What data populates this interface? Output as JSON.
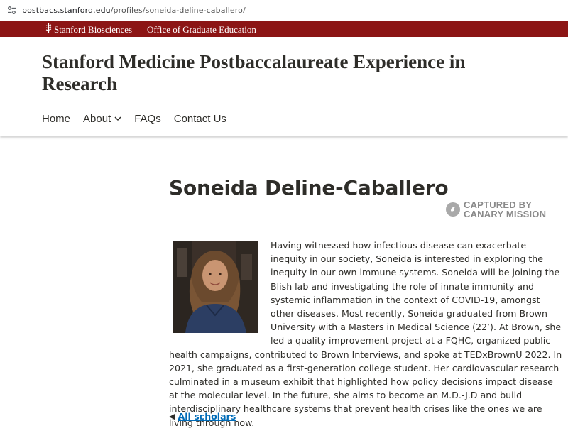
{
  "browser": {
    "url_host": "postbacs.stanford.edu",
    "url_path": "/profiles/soneida-deline-caballero/"
  },
  "brandbar": {
    "brand_label": "Stanford Biosciences",
    "office_label": "Office of Graduate Education"
  },
  "header": {
    "site_title": "Stanford Medicine Postbaccalaureate Experience in Research"
  },
  "nav": {
    "items": [
      {
        "label": "Home"
      },
      {
        "label": "About"
      },
      {
        "label": "FAQs"
      },
      {
        "label": "Contact Us"
      }
    ]
  },
  "watermark": {
    "line1": "CAPTURED BY",
    "line2": "CANARY MISSION"
  },
  "profile": {
    "name": "Soneida Deline-Caballero",
    "bio": "Having witnessed how infectious disease can exacerbate inequity in our society, Soneida is interested in exploring the inequity in our own immune systems. Soneida will be joining the Blish lab and investigating the role of innate immunity and systemic inflammation in the context of COVID-19, amongst other diseases. Most recently, Soneida graduated from Brown University with a Masters in Medical Science (22’). At Brown, she led a quality improvement project at a FQHC, organized public health campaigns, contributed to Brown Interviews, and spoke at TEDxBrownU 2022. In 2021, she graduated as a first-generation college student. Her cardiovascular research culminated in a museum exhibit that highlighted how policy decisions impact disease at the molecular level. In the future, she aims to become an M.D.-J.D and build interdisciplinary healthcare systems that prevent health crises like the ones we are living through now.",
    "back_arrow": "◀",
    "back_link": "All scholars"
  },
  "colors": {
    "cardinal": "#8c1515",
    "link": "#006cb8",
    "text": "#2e2d29"
  }
}
